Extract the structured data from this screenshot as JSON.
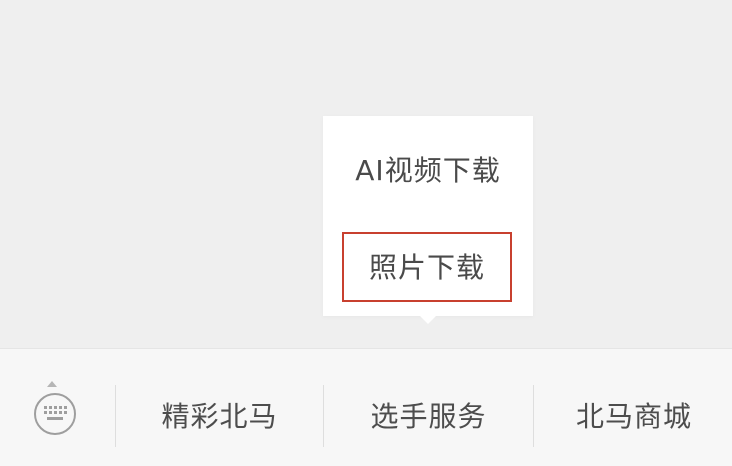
{
  "popup": {
    "items": [
      {
        "label": "AI视频下载"
      },
      {
        "label": "照片下载"
      }
    ],
    "highlight_color": "#c8402f"
  },
  "bottom_bar": {
    "keyboard_icon": "keyboard-icon",
    "tabs": [
      {
        "label": "精彩北马"
      },
      {
        "label": "选手服务"
      },
      {
        "label": "北马商城"
      }
    ]
  }
}
